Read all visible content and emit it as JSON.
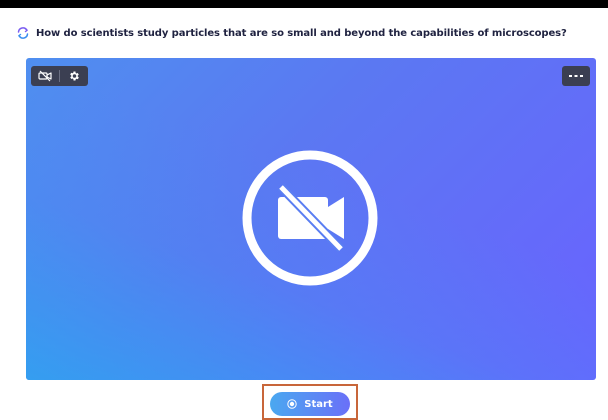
{
  "question": {
    "text": "How do scientists study particles that are so small and beyond the capabilities of microscopes?",
    "icon": "refresh-icon"
  },
  "video": {
    "toolbar_left": {
      "icons": [
        "camera-off-icon",
        "gear-icon"
      ]
    },
    "toolbar_right": {
      "icon": "more-options-icon"
    },
    "placeholder_icon": "camera-off-icon"
  },
  "actions": {
    "start_label": "Start",
    "start_icon": "record-icon"
  },
  "colors": {
    "gradient_start": "#2fa8ee",
    "gradient_end": "#6a62ff",
    "highlight_border": "#c8663a",
    "question_text": "#1f2240"
  }
}
